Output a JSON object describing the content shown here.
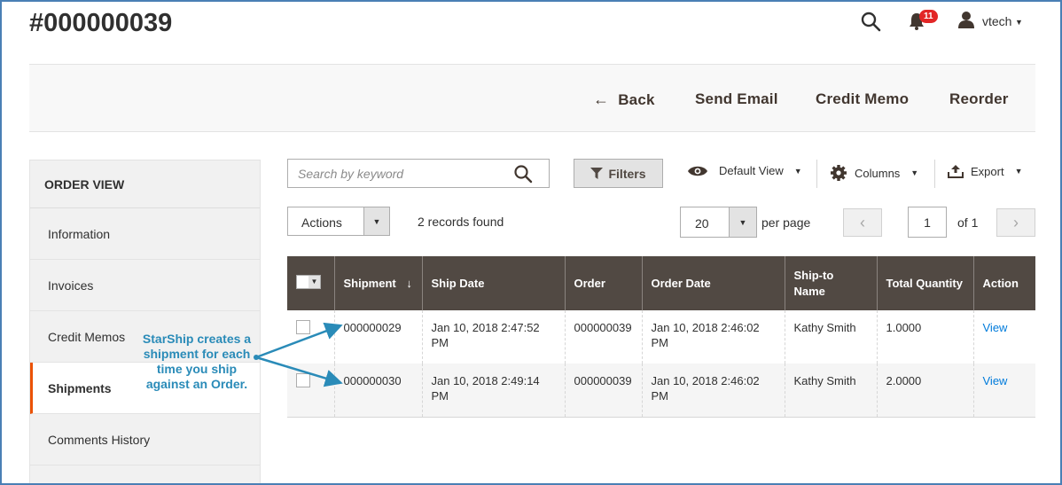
{
  "page": {
    "title": "#000000039"
  },
  "topbar": {
    "notification_count": "11",
    "user_name": "vtech"
  },
  "action_bar": {
    "back": "Back",
    "send_email": "Send Email",
    "credit_memo": "Credit Memo",
    "reorder": "Reorder"
  },
  "sidebar": {
    "heading": "ORDER VIEW",
    "items": [
      {
        "label": "Information",
        "active": false
      },
      {
        "label": "Invoices",
        "active": false
      },
      {
        "label": "Credit Memos",
        "active": false
      },
      {
        "label": "Shipments",
        "active": true
      },
      {
        "label": "Comments History",
        "active": false
      }
    ]
  },
  "grid_toolbar": {
    "search_placeholder": "Search by keyword",
    "filters": "Filters",
    "default_view": "Default View",
    "columns": "Columns",
    "export": "Export",
    "actions": "Actions",
    "records_found": "2 records found",
    "per_page_value": "20",
    "per_page_label": "per page",
    "current_page": "1",
    "of_pages": "of 1"
  },
  "table": {
    "headers": [
      "Shipment",
      "Ship Date",
      "Order",
      "Order Date",
      "Ship-to Name",
      "Total Quantity",
      "Action"
    ],
    "sort_indicator": "↓",
    "rows": [
      {
        "shipment": "000000029",
        "ship_date": "Jan 10, 2018 2:47:52 PM",
        "order": "000000039",
        "order_date": "Jan 10, 2018 2:46:02 PM",
        "ship_to": "Kathy Smith",
        "qty": "1.0000",
        "action": "View"
      },
      {
        "shipment": "000000030",
        "ship_date": "Jan 10, 2018 2:49:14 PM",
        "order": "000000039",
        "order_date": "Jan 10, 2018 2:46:02 PM",
        "ship_to": "Kathy Smith",
        "qty": "2.0000",
        "action": "View"
      }
    ]
  },
  "annotation": {
    "text": "StarShip creates a shipment for each time you ship against an Order.",
    "color": "#2a8bb8"
  },
  "colors": {
    "header_bg": "#514943",
    "accent": "#eb5202",
    "link": "#007bdb",
    "badge": "#e22626"
  }
}
